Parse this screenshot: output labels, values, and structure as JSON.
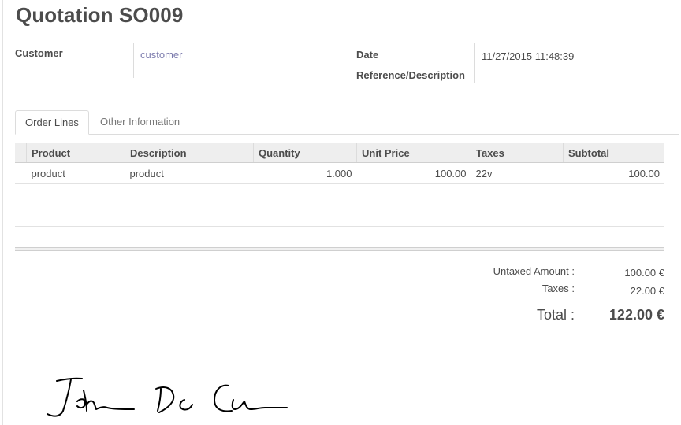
{
  "form": {
    "title": "Quotation SO009",
    "customer_label": "Customer",
    "customer_value": "customer",
    "date_label": "Date",
    "date_value": "11/27/2015 11:48:39",
    "reference_label": "Reference/Description"
  },
  "tabs": [
    {
      "label": "Order Lines",
      "active": true
    },
    {
      "label": "Other Information",
      "active": false
    }
  ],
  "order_lines": {
    "columns": [
      "Product",
      "Description",
      "Quantity",
      "Unit Price",
      "Taxes",
      "Subtotal"
    ],
    "rows": [
      {
        "product": "product",
        "description": "product",
        "quantity": "1.000",
        "unit_price": "100.00",
        "taxes": "22v",
        "subtotal": "100.00"
      }
    ]
  },
  "totals": {
    "untaxed_label": "Untaxed Amount :",
    "untaxed_value": "100.00 €",
    "taxes_label": "Taxes :",
    "taxes_value": "22.00 €",
    "total_label": "Total :",
    "total_value": "122.00 €"
  },
  "signature": {
    "text": "John McCann",
    "stroke_color": "#000000"
  },
  "colors": {
    "link": "#7c7bad",
    "text": "#4c4c4c",
    "header_bg": "#eeeeee"
  }
}
